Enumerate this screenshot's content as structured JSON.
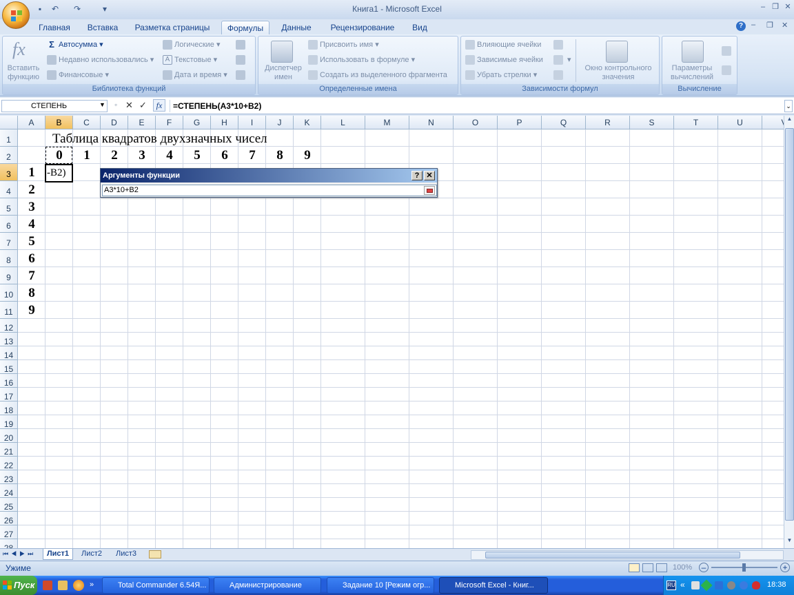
{
  "window": {
    "title": "Книга1 - Microsoft Excel"
  },
  "ribbon": {
    "tabs": [
      "Главная",
      "Вставка",
      "Разметка страницы",
      "Формулы",
      "Данные",
      "Рецензирование",
      "Вид"
    ],
    "active_tab": "Формулы",
    "groups": {
      "function_library": {
        "label": "Библиотека функций",
        "insert_function": "Вставить функцию",
        "autosum": "Автосумма",
        "recent": "Недавно использовались",
        "financial": "Финансовые",
        "logical": "Логические",
        "text": "Текстовые",
        "datetime": "Дата и время"
      },
      "defined_names": {
        "label": "Определенные имена",
        "name_manager": "Диспетчер имен",
        "define_name": "Присвоить имя",
        "use_in_formula": "Использовать в формуле",
        "create_from_selection": "Создать из выделенного фрагмента"
      },
      "formula_auditing": {
        "label": "Зависимости формул",
        "trace_precedents": "Влияющие ячейки",
        "trace_dependents": "Зависимые ячейки",
        "remove_arrows": "Убрать стрелки",
        "watch_window": "Окно контрольного значения"
      },
      "calculation": {
        "label": "Вычисление",
        "options": "Параметры вычислений"
      }
    }
  },
  "formula_bar": {
    "name_box": "СТЕПЕНЬ",
    "formula": "=СТЕПЕНЬ(A3*10+B2)"
  },
  "sheet": {
    "columns": [
      "A",
      "B",
      "C",
      "D",
      "E",
      "F",
      "G",
      "H",
      "I",
      "J",
      "K",
      "L",
      "M",
      "N",
      "O",
      "P",
      "Q",
      "R",
      "S",
      "T",
      "U",
      "V"
    ],
    "rows": [
      "1",
      "2",
      "3",
      "4",
      "5",
      "6",
      "7",
      "8",
      "9",
      "10",
      "11",
      "12",
      "13",
      "14",
      "15",
      "16",
      "17",
      "18",
      "19",
      "20",
      "21",
      "22",
      "23",
      "24",
      "25",
      "26",
      "27",
      "28"
    ],
    "title": "Таблица квадратов двухзначных чисел",
    "header_digits": [
      "0",
      "1",
      "2",
      "3",
      "4",
      "5",
      "6",
      "7",
      "8",
      "9"
    ],
    "row_digits": [
      "1",
      "2",
      "3",
      "4",
      "5",
      "6",
      "7",
      "8",
      "9"
    ],
    "active_cell_text": "-B2)"
  },
  "dialog": {
    "title": "Аргументы функции",
    "input": "A3*10+B2",
    "help": "?",
    "close": "✕"
  },
  "sheet_tabs": [
    "Лист1",
    "Лист2",
    "Лист3"
  ],
  "status": {
    "mode": "Ужиме",
    "zoom": "100%"
  },
  "taskbar": {
    "start": "Пуск",
    "tasks": [
      "Total Commander 6.54Я...",
      "Администрирование",
      "Задание 10 [Режим огр...",
      "Microsoft Excel - Книг..."
    ],
    "lang": "RU",
    "clock": "18:38"
  }
}
